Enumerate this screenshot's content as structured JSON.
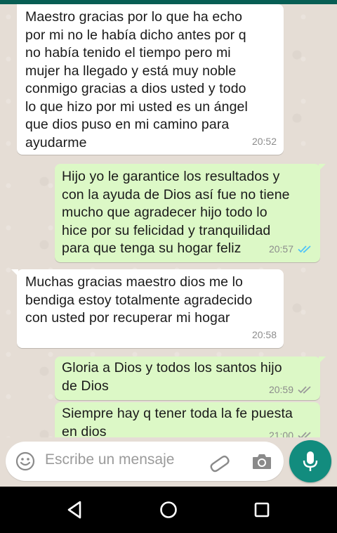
{
  "composer": {
    "placeholder": "Escribe un mensaje"
  },
  "messages": [
    {
      "direction": "incoming",
      "text": "Maestro gracias por lo que ha echo\npor mi no le había dicho antes por q\nno había tenido el tiempo pero mi\nmujer ha llegado y está muy noble\nconmigo gracias a dios usted  y todo\nlo que hizo por mi usted es un ángel\nque dios puso en mi camino para\nayudarme",
      "time": "20:52"
    },
    {
      "direction": "outgoing",
      "text": "Hijo yo le garantice los resultados y\ncon la ayuda de Dios así fue no tiene\nmucho que agradecer hijo todo lo\nhice por su felicidad y tranquilidad\npara que tenga su hogar feliz",
      "time": "20:57",
      "status": "read"
    },
    {
      "direction": "incoming",
      "text": "Muchas gracias maestro dios me lo\nbendiga estoy totalmente agradecido\ncon usted por recuperar mi hogar",
      "time": "20:58"
    },
    {
      "direction": "outgoing",
      "text": "Gloria a Dios y todos los santos hijo\nde Dios",
      "time": "20:59",
      "status": "delivered"
    },
    {
      "direction": "outgoing",
      "text": "Siempre hay q tener toda la fe puesta\nen dios",
      "time": "21:00",
      "status": "delivered"
    }
  ],
  "colors": {
    "incoming_bubble": "#ffffff",
    "outgoing_bubble": "#dcf8c6",
    "read_ticks": "#4fc3f7",
    "accent": "#128c7e",
    "chat_background": "#e5ddd5"
  },
  "icons": {
    "composer_left": "emoji-icon",
    "attach": "paperclip-icon",
    "camera": "camera-icon",
    "send": "microphone-icon",
    "nav_back": "back-triangle-icon",
    "nav_home": "home-circle-icon",
    "nav_recents": "recents-square-icon"
  }
}
